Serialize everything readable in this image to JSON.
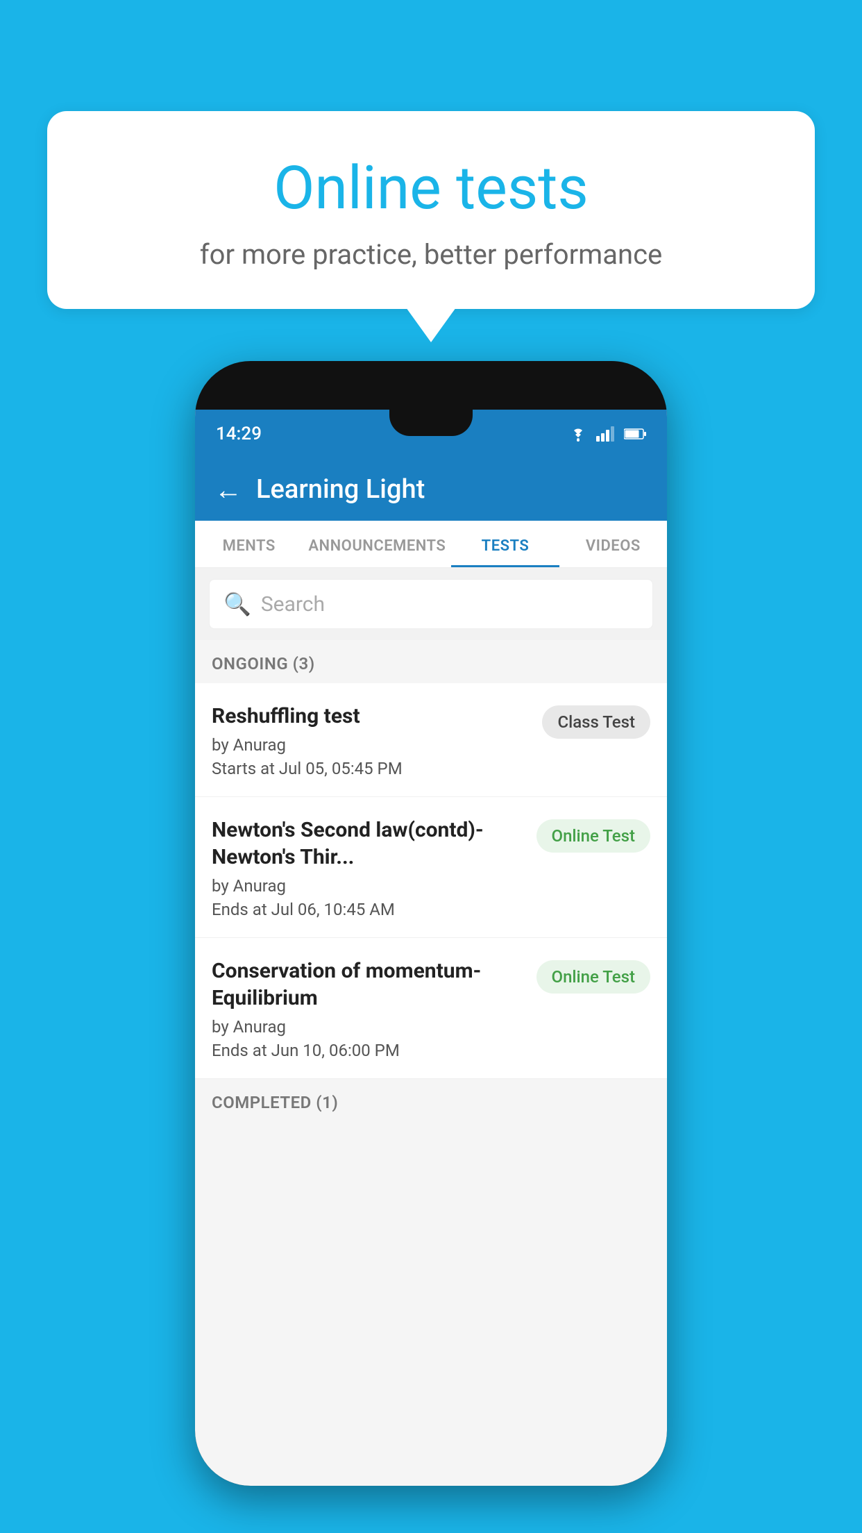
{
  "background": {
    "color": "#1ab4e8"
  },
  "speech_bubble": {
    "title": "Online tests",
    "subtitle": "for more practice, better performance"
  },
  "phone": {
    "status_bar": {
      "time": "14:29"
    },
    "app_bar": {
      "title": "Learning Light",
      "back_label": "←"
    },
    "tabs": [
      {
        "label": "MENTS",
        "active": false
      },
      {
        "label": "ANNOUNCEMENTS",
        "active": false
      },
      {
        "label": "TESTS",
        "active": true
      },
      {
        "label": "VIDEOS",
        "active": false
      }
    ],
    "search": {
      "placeholder": "Search"
    },
    "ongoing_section": {
      "header": "ONGOING (3)"
    },
    "tests": [
      {
        "title": "Reshuffling test",
        "author": "by Anurag",
        "time": "Starts at  Jul 05, 05:45 PM",
        "badge": "Class Test",
        "badge_type": "class"
      },
      {
        "title": "Newton's Second law(contd)-Newton's Thir...",
        "author": "by Anurag",
        "time": "Ends at  Jul 06, 10:45 AM",
        "badge": "Online Test",
        "badge_type": "online"
      },
      {
        "title": "Conservation of momentum-Equilibrium",
        "author": "by Anurag",
        "time": "Ends at  Jun 10, 06:00 PM",
        "badge": "Online Test",
        "badge_type": "online"
      }
    ],
    "completed_section": {
      "header": "COMPLETED (1)"
    }
  }
}
